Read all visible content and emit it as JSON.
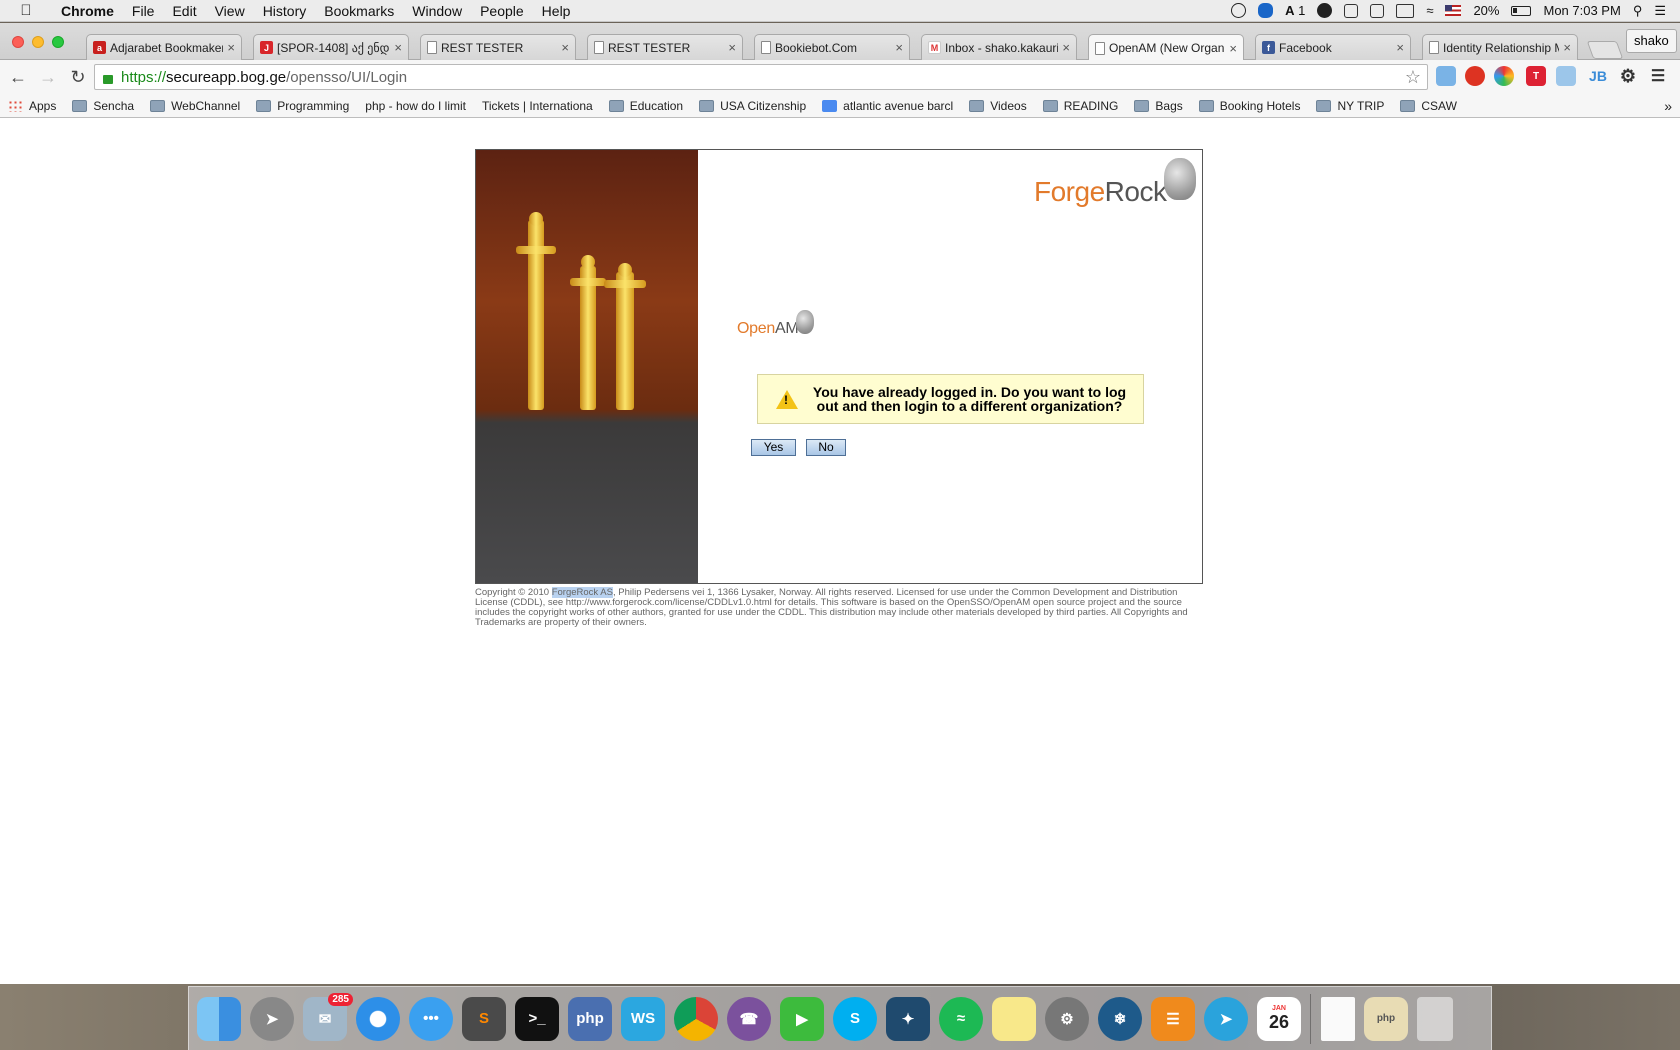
{
  "menubar": {
    "app": "Chrome",
    "items": [
      "File",
      "Edit",
      "View",
      "History",
      "Bookmarks",
      "Window",
      "People",
      "Help"
    ],
    "status": {
      "adobe_count": "1",
      "battery": "20%",
      "clock": "Mon 7:03 PM"
    }
  },
  "tabs": [
    {
      "title": "Adjarabet Bookmaker",
      "favicon": "adjarabet-icon",
      "color": "#c8201e"
    },
    {
      "title": "[SPOR-1408] აქ ენდე",
      "favicon": "jira-icon",
      "color": "#d8262a"
    },
    {
      "title": "REST TESTER",
      "favicon": "page-icon"
    },
    {
      "title": "REST TESTER",
      "favicon": "page-icon"
    },
    {
      "title": "Bookiebot.Com",
      "favicon": "page-icon"
    },
    {
      "title": "Inbox - shako.kakauri",
      "favicon": "gmail-icon",
      "color": "#d33"
    },
    {
      "title": "OpenAM (New Organization)",
      "favicon": "page-icon",
      "active": true
    },
    {
      "title": "Facebook",
      "favicon": "facebook-icon",
      "color": "#3b5998"
    },
    {
      "title": "Identity Relationship Management",
      "favicon": "page-icon"
    }
  ],
  "profile": "shako",
  "address": {
    "scheme": "https://",
    "host": "secureapp.bog.ge",
    "path": "/opensso/UI/Login"
  },
  "bookmarks": [
    {
      "label": "Apps",
      "icon": "apps"
    },
    {
      "label": "Sencha",
      "icon": "folder"
    },
    {
      "label": "WebChannel",
      "icon": "folder"
    },
    {
      "label": "Programming",
      "icon": "folder"
    },
    {
      "label": "php - how do I limit",
      "icon": "page"
    },
    {
      "label": "Tickets | Internationa",
      "icon": "page"
    },
    {
      "label": "Education",
      "icon": "folder"
    },
    {
      "label": "USA Citizenship",
      "icon": "folder"
    },
    {
      "label": "atlantic avenue barcl",
      "icon": "g"
    },
    {
      "label": "Videos",
      "icon": "folder"
    },
    {
      "label": "READING",
      "icon": "folder"
    },
    {
      "label": "Bags",
      "icon": "folder"
    },
    {
      "label": "Booking Hotels",
      "icon": "folder"
    },
    {
      "label": "NY TRIP",
      "icon": "folder"
    },
    {
      "label": "CSAW",
      "icon": "folder"
    }
  ],
  "login": {
    "brand_a": "Forge",
    "brand_b": "Rock",
    "product_a": "Open",
    "product_b": "AM",
    "message": "You have already logged in. Do you want to log out and then login to a different organization?",
    "yes": "Yes",
    "no": "No"
  },
  "footer": {
    "pre": "Copyright © 2010 ",
    "highlight": "ForgeRock AS",
    "post": ", Philip Pedersens vei 1, 1366 Lysaker, Norway. All rights reserved. Licensed for use under the Common Development and Distribution License (CDDL), see http://www.forgerock.com/license/CDDLv1.0.html for details. This software is based on the OpenSSO/OpenAM open source project and the source includes the copyright works of other authors, granted for use under the CDDL. This distribution may include other materials developed by third parties. All Copyrights and Trademarks are property of their owners."
  },
  "dock": {
    "mail_badge": "285",
    "calendar_month": "JAN",
    "calendar_day": "26",
    "php_label": "php"
  }
}
